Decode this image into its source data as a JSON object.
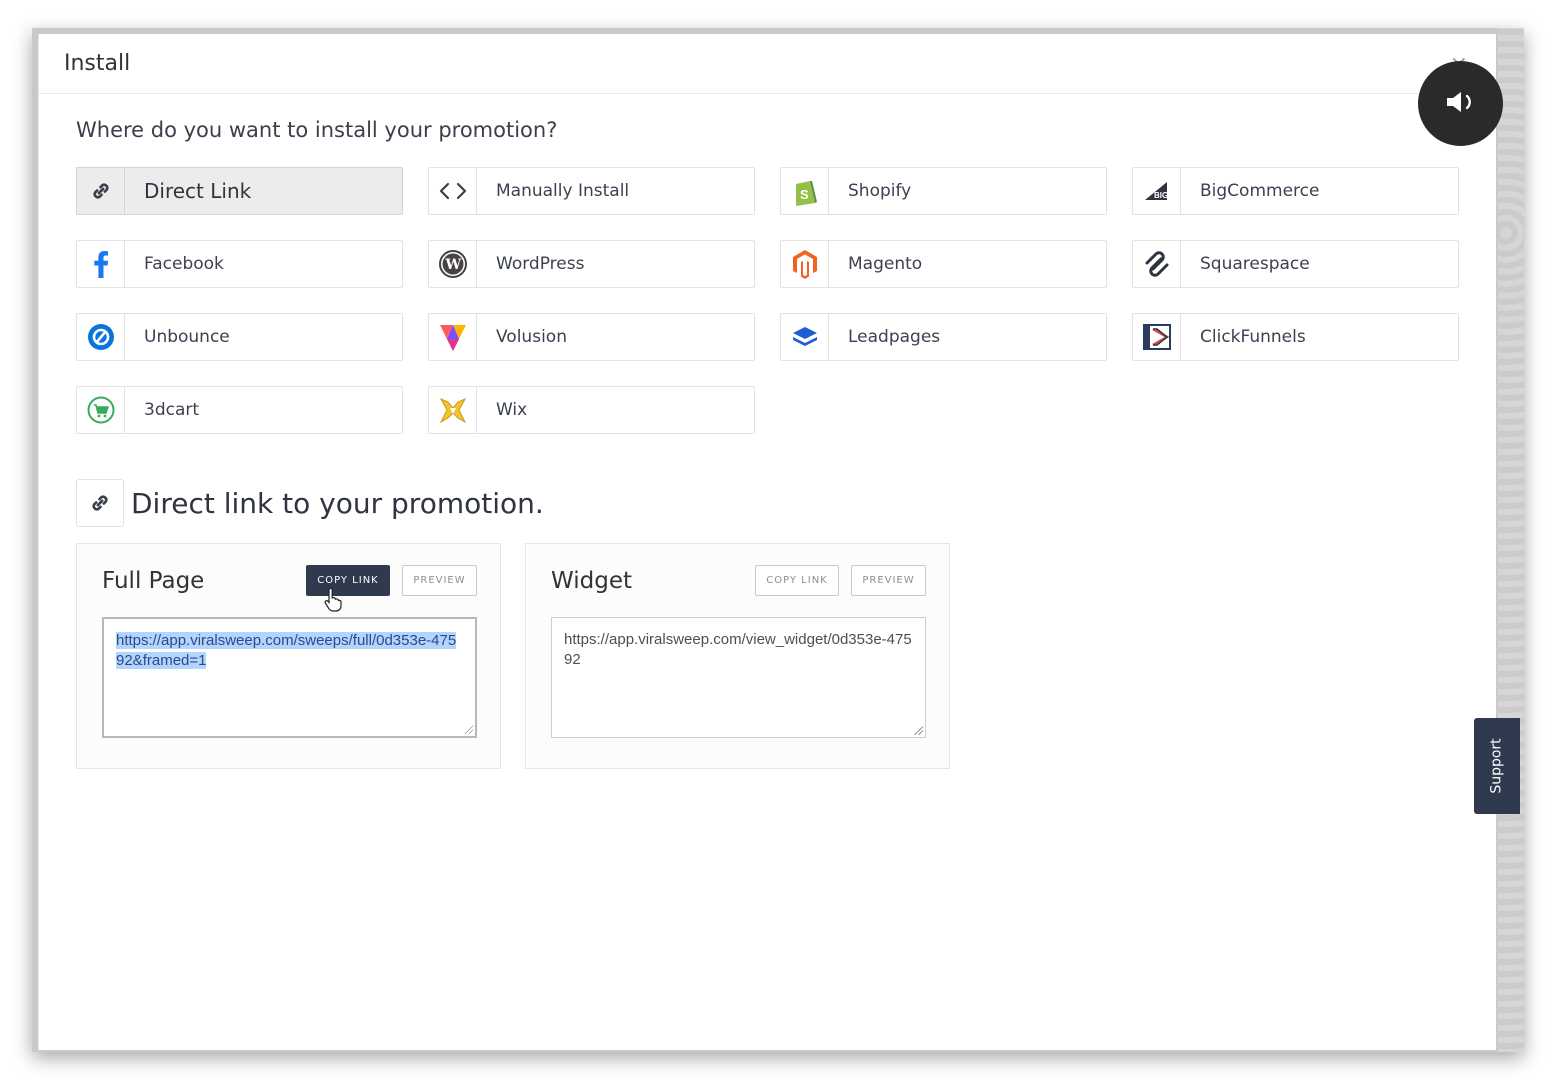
{
  "modal": {
    "title": "Install",
    "close_label": "×"
  },
  "install": {
    "question": "Where do you want to install your promotion?",
    "platforms": [
      {
        "label": "Direct Link",
        "icon": "link-icon",
        "active": true
      },
      {
        "label": "Manually Install",
        "icon": "code-icon"
      },
      {
        "label": "Shopify",
        "icon": "shopify-icon"
      },
      {
        "label": "BigCommerce",
        "icon": "bigcommerce-icon"
      },
      {
        "label": "Facebook",
        "icon": "facebook-icon"
      },
      {
        "label": "WordPress",
        "icon": "wordpress-icon"
      },
      {
        "label": "Magento",
        "icon": "magento-icon"
      },
      {
        "label": "Squarespace",
        "icon": "squarespace-icon"
      },
      {
        "label": "Unbounce",
        "icon": "unbounce-icon"
      },
      {
        "label": "Volusion",
        "icon": "volusion-icon"
      },
      {
        "label": "Leadpages",
        "icon": "leadpages-icon"
      },
      {
        "label": "ClickFunnels",
        "icon": "clickfunnels-icon"
      },
      {
        "label": "3dcart",
        "icon": "3dcart-icon"
      },
      {
        "label": "Wix",
        "icon": "wix-icon"
      }
    ]
  },
  "direct_link": {
    "heading": "Direct link to your promotion.",
    "full_page": {
      "title": "Full Page",
      "copy_label": "COPY LINK",
      "preview_label": "PREVIEW",
      "url": "https://app.viralsweep.com/sweeps/full/0d353e-47592&framed=1"
    },
    "widget": {
      "title": "Widget",
      "copy_label": "COPY LINK",
      "preview_label": "PREVIEW",
      "url": "https://app.viralsweep.com/view_widget/0d353e-47592"
    }
  },
  "support": {
    "label": "Support"
  },
  "colors": {
    "primary_dark": "#2f3a4f",
    "selection": "#b3d4fc",
    "shopify_green": "#95bf47",
    "facebook_blue": "#1877f2",
    "magento_orange": "#f26322",
    "unbounce_blue": "#0a74da",
    "leadpages_blue": "#1d5dd8",
    "cart_green": "#3aaa5c"
  }
}
